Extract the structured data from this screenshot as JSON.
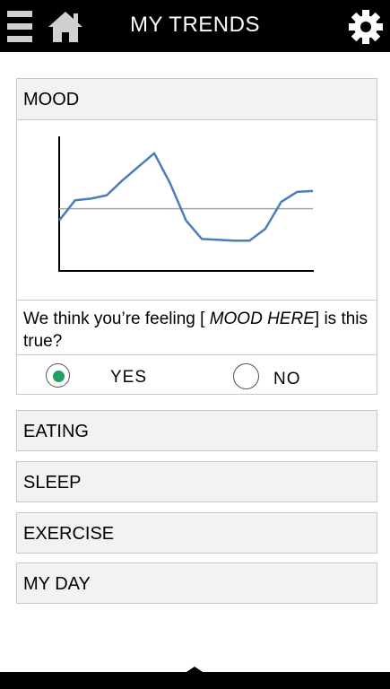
{
  "header": {
    "title": "MY TRENDS",
    "menu_icon": "hamburger-menu-icon",
    "home_icon": "home-icon",
    "settings_icon": "gear-icon"
  },
  "mood": {
    "label": "MOOD",
    "question_prefix": "We think you’re feeling [ ",
    "question_placeholder": "MOOD HERE",
    "question_suffix": "] is this true?",
    "options": [
      {
        "label": "YES",
        "selected": true
      },
      {
        "label": "NO",
        "selected": false
      }
    ]
  },
  "chart_data": {
    "type": "line",
    "series": [
      {
        "values": [
          3.0,
          4.2,
          4.3,
          4.5,
          5.4,
          6.2,
          7.0,
          5.2,
          3.0,
          1.9,
          1.85,
          1.8,
          1.8,
          2.5,
          4.1,
          4.7,
          4.75
        ]
      },
      {
        "values": [
          3.7,
          3.7,
          3.7,
          3.7,
          3.7,
          3.7,
          3.7,
          3.7,
          3.7,
          3.7,
          3.7,
          3.7,
          3.7,
          3.7,
          3.7,
          3.7,
          3.7
        ]
      }
    ],
    "series_colors": [
      "#4a7ebb",
      "#a6a6a6"
    ],
    "ylim": [
      0,
      8
    ],
    "xlim": [
      0,
      16
    ],
    "grid": false
  },
  "sections": [
    {
      "label": "EATING"
    },
    {
      "label": "SLEEP"
    },
    {
      "label": "EXERCISE"
    },
    {
      "label": "MY DAY"
    }
  ]
}
